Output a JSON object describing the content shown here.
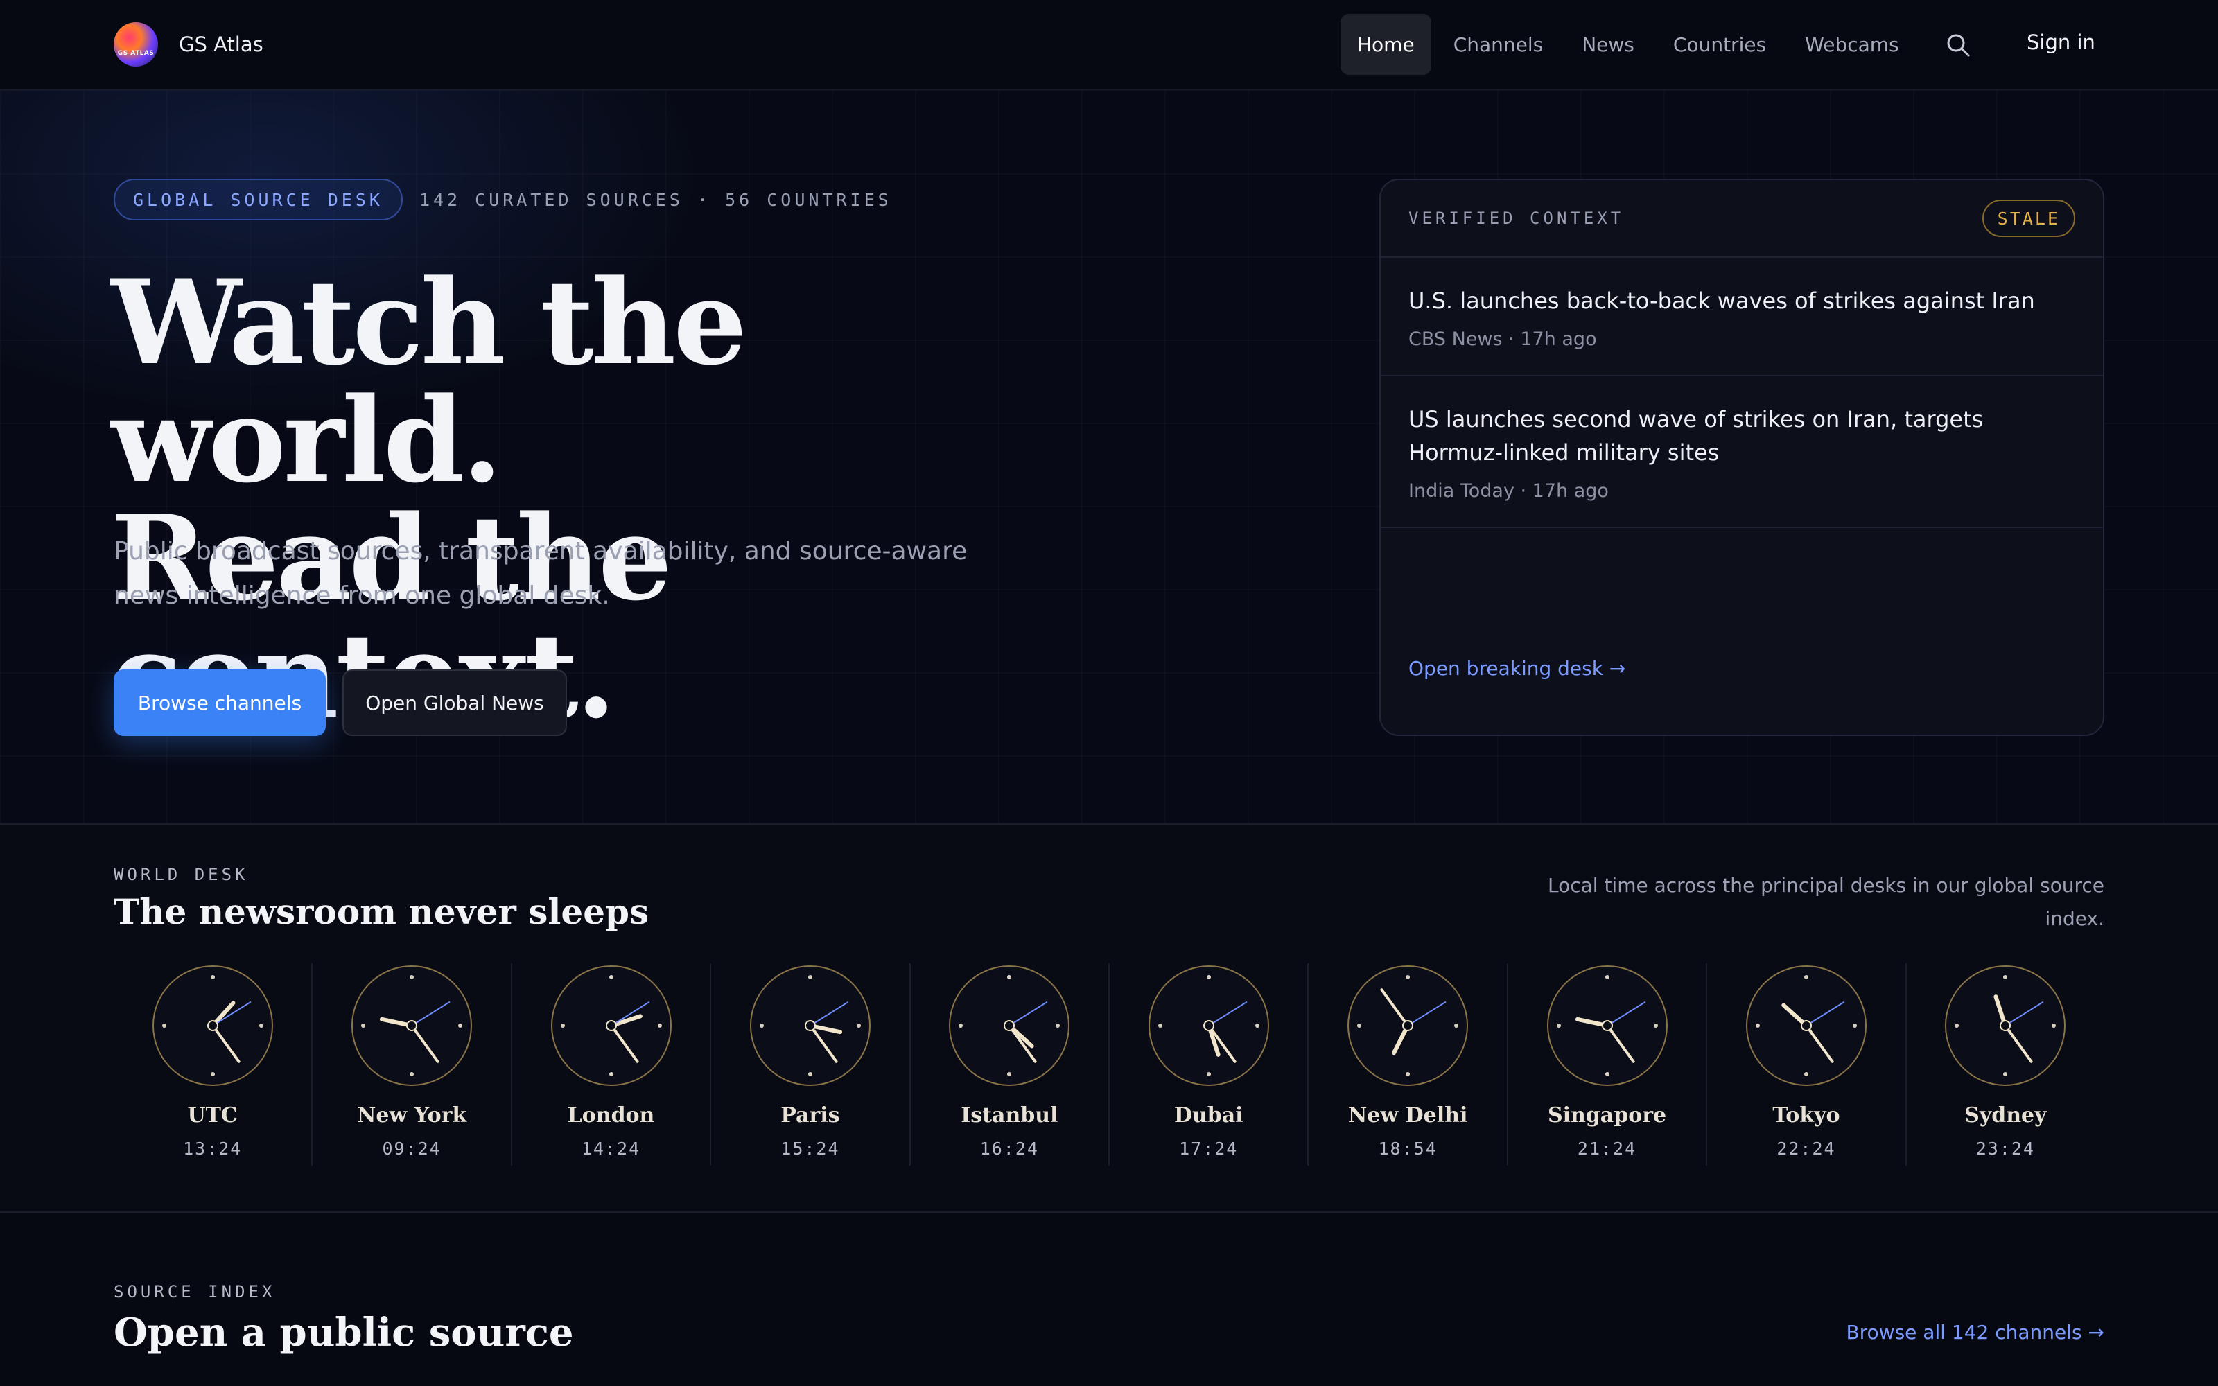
{
  "nav": {
    "brand": "GS Atlas",
    "logo_text": "GS ATLAS",
    "links": [
      "Home",
      "Channels",
      "News",
      "Countries",
      "Webcams"
    ],
    "active": "Home",
    "signin": "Sign in"
  },
  "hero": {
    "badge": "GLOBAL SOURCE DESK",
    "meta": "142 CURATED SOURCES · 56 COUNTRIES",
    "headline_1": "Watch the world.",
    "headline_2": "Read the context.",
    "subhead": "Public broadcast sources, transparent availability, and source-aware news intelligence from one global desk.",
    "primary_cta": "Browse channels",
    "secondary_cta": "Open Global News"
  },
  "verified": {
    "title": "VERIFIED CONTEXT",
    "status": "STALE",
    "items": [
      {
        "title": "U.S. launches back-to-back waves of strikes against Iran",
        "meta": "CBS News · 17h ago"
      },
      {
        "title": "US launches second wave of strikes on Iran, targets Hormuz-linked military sites",
        "meta": "India Today · 17h ago"
      }
    ],
    "link": "Open breaking desk →"
  },
  "world": {
    "eyebrow": "WORLD DESK",
    "title": "The newsroom never sleeps",
    "note": "Local time across the principal desks in our global source index.",
    "clocks": [
      {
        "city": "UTC",
        "time": "13:24"
      },
      {
        "city": "New York",
        "time": "09:24"
      },
      {
        "city": "London",
        "time": "14:24"
      },
      {
        "city": "Paris",
        "time": "15:24"
      },
      {
        "city": "Istanbul",
        "time": "16:24"
      },
      {
        "city": "Dubai",
        "time": "17:24"
      },
      {
        "city": "New Delhi",
        "time": "18:54"
      },
      {
        "city": "Singapore",
        "time": "21:24"
      },
      {
        "city": "Tokyo",
        "time": "22:24"
      },
      {
        "city": "Sydney",
        "time": "23:24"
      }
    ]
  },
  "source": {
    "eyebrow": "SOURCE INDEX",
    "title": "Open a public source",
    "browse_all": "Browse all 142 channels →"
  },
  "colors": {
    "accent": "#3b82f6",
    "link": "#7c9bff",
    "stale": "#e3b14a",
    "clock_ring": "#8a7448",
    "clock_hand": "#f1e6cc",
    "clock_second": "#6f8dff"
  }
}
